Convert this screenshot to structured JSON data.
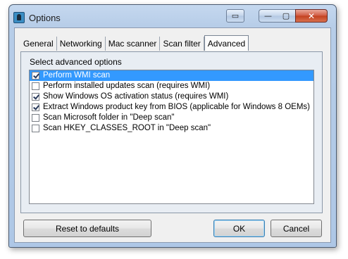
{
  "window": {
    "title": "Options",
    "controls": {
      "dock_glyph": "▭",
      "minimize_glyph": "—",
      "maximize_glyph": "▢",
      "close_glyph": "✕"
    }
  },
  "tabs": [
    {
      "label": "General",
      "active": false
    },
    {
      "label": "Networking",
      "active": false
    },
    {
      "label": "Mac scanner",
      "active": false
    },
    {
      "label": "Scan filter",
      "active": false
    },
    {
      "label": "Advanced",
      "active": true
    }
  ],
  "advanced": {
    "section_label": "Select advanced options",
    "options": [
      {
        "label": "Perform WMI scan",
        "checked": true,
        "selected": true
      },
      {
        "label": "Perform installed updates scan (requires WMI)",
        "checked": false,
        "selected": false
      },
      {
        "label": "Show Windows OS activation status (requires WMI)",
        "checked": true,
        "selected": false
      },
      {
        "label": "Extract Windows product key from BIOS (applicable for Windows 8 OEMs)",
        "checked": true,
        "selected": false
      },
      {
        "label": "Scan Microsoft folder in \"Deep scan\"",
        "checked": false,
        "selected": false
      },
      {
        "label": "Scan HKEY_CLASSES_ROOT in \"Deep scan\"",
        "checked": false,
        "selected": false
      }
    ]
  },
  "buttons": {
    "reset": "Reset to defaults",
    "ok": "OK",
    "cancel": "Cancel"
  },
  "colors": {
    "selection": "#3399ff",
    "title_bar": "#b7cde8",
    "close_button": "#c2401f"
  }
}
